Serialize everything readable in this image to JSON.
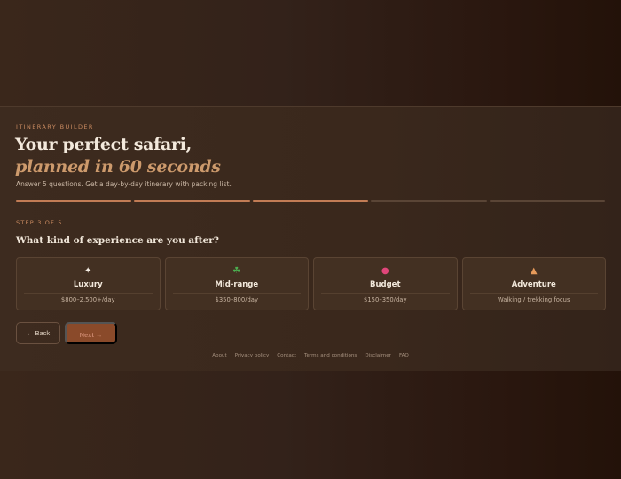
{
  "header": {
    "eyebrow": "ITINERARY BUILDER",
    "title_line1": "Your perfect safari,",
    "title_line2": "planned in 60 seconds",
    "subtitle": "Answer 5 questions. Get a day-by-day itinerary with packing list."
  },
  "progress": {
    "total_steps": 5,
    "current_step": 3,
    "segments": [
      "done",
      "done",
      "done",
      "pending",
      "pending"
    ]
  },
  "step_label": "STEP 3 OF 5",
  "question": "What kind of experience are you after?",
  "options": [
    {
      "icon": "sparkle-icon",
      "glyph": "✦",
      "title": "Luxury",
      "price": "$800–2,500+/day"
    },
    {
      "icon": "leaf-icon",
      "glyph": "☘",
      "title": "Mid-range",
      "price": "$350–800/day"
    },
    {
      "icon": "piggy-bank-icon",
      "glyph": "●",
      "title": "Budget",
      "price": "$150–350/day"
    },
    {
      "icon": "hiking-boot-icon",
      "glyph": "▲",
      "title": "Adventure",
      "price": "Walking / trekking focus"
    }
  ],
  "buttons": {
    "back": "← Back",
    "next": "Next →"
  },
  "footer": {
    "links": [
      "About",
      "Privacy policy",
      "Contact",
      "Terms and conditions",
      "Disclaimer",
      "FAQ"
    ]
  },
  "colors": {
    "accent": "#c27c55",
    "accent_text": "#cd9a6c",
    "background": "#33221a",
    "panel": "#3d2b1f",
    "next_button": "#8a4a2a"
  }
}
